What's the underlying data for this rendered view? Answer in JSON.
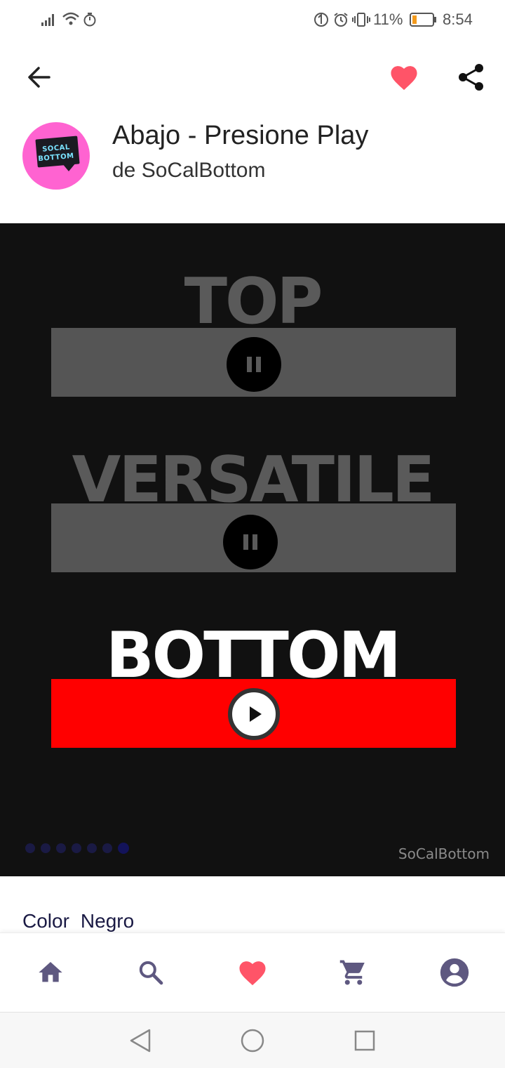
{
  "status_bar": {
    "battery_percent": "11%",
    "time": "8:54"
  },
  "header": {
    "back_icon": "arrow-back-icon",
    "favorite_icon": "heart-icon",
    "share_icon": "share-icon"
  },
  "store": {
    "logo_line1": "SOCAL",
    "logo_line2": "BOTTOM",
    "product_title": "Abajo - Presione Play",
    "store_name": "de SoCalBottom"
  },
  "product_image": {
    "word_top": "TOP",
    "word_versatile": "VERSATILE",
    "word_bottom": "BOTTOM",
    "watermark": "SoCalBottom",
    "dot_count": 7,
    "active_dot": 7
  },
  "details": {
    "color_label": "Color",
    "color_value": "Negro"
  },
  "bottom_nav": {
    "items": [
      "home-icon",
      "search-icon",
      "heart-icon",
      "cart-icon",
      "account-icon"
    ]
  },
  "colors": {
    "accent_heart": "#ff5468",
    "nav_icon": "#5e5880",
    "red_bar": "#ff0000"
  }
}
